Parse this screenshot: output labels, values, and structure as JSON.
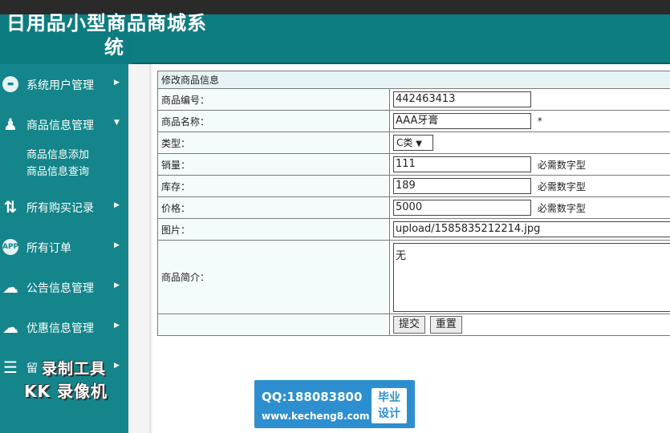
{
  "app": {
    "title_line1": "日用品小型商品商城系",
    "title_line2": "统"
  },
  "sidebar": {
    "items": [
      {
        "label": "系统用户管理",
        "icon": "monitor-icon",
        "arrow": "▶"
      },
      {
        "label": "商品信息管理",
        "icon": "user-gear-icon",
        "arrow": "▼",
        "children": [
          "商品信息添加",
          "商品信息查询"
        ]
      },
      {
        "label": "所有购买记录",
        "icon": "transfer-arrows-icon",
        "arrow": "▶"
      },
      {
        "label": "所有订单",
        "icon": "app-icon",
        "icon_text": "APP",
        "arrow": "▶"
      },
      {
        "label": "公告信息管理",
        "icon": "cloud-icon",
        "arrow": "▶"
      },
      {
        "label": "优惠信息管理",
        "icon": "cloud-icon",
        "arrow": "▶"
      },
      {
        "label": "留",
        "icon": "stack-icon",
        "arrow": "▶"
      }
    ]
  },
  "form": {
    "title": "修改商品信息",
    "fields": {
      "code": {
        "label": "商品编号：",
        "value": "442463413"
      },
      "name": {
        "label": "商品名称：",
        "value": "AAA牙膏",
        "required": "*"
      },
      "type": {
        "label": "类型：",
        "value": "C类",
        "caret": "▼"
      },
      "sales": {
        "label": "销量：",
        "value": "111",
        "hint": "必需数字型"
      },
      "stock": {
        "label": "库存：",
        "value": "189",
        "hint": "必需数字型"
      },
      "price": {
        "label": "价格：",
        "value": "5000",
        "hint": "必需数字型"
      },
      "image": {
        "label": "图片：",
        "value": "upload/1585835212214.jpg"
      },
      "intro": {
        "label": "商品简介：",
        "value": "无"
      }
    },
    "submit_label": "提交",
    "reset_label": "重置"
  },
  "watermarks": {
    "recorder_line1": "录制工具",
    "recorder_line2": "KK 录像机",
    "qq": "QQ:188083800",
    "url": "www.kecheng8.com",
    "badge_line1": "毕业",
    "badge_line2": "设计"
  },
  "colors": {
    "header": "#0d7c80",
    "sidebar": "#14858b",
    "watermark_blue": "#2d8fd0"
  }
}
